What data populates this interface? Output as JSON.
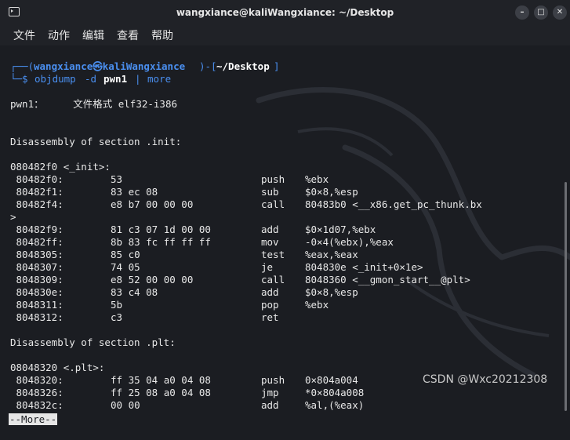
{
  "window": {
    "title": "wangxiance@kaliWangxiance: ~/Desktop",
    "buttons": {
      "minimize": "–",
      "maximize": "□",
      "close": "✕"
    }
  },
  "menu": [
    "文件",
    "动作",
    "编辑",
    "查看",
    "帮助"
  ],
  "prompt": {
    "line1_open": "┌──(",
    "user_host": "wangxiance㉿kaliWangxiance",
    "line1_mid": ")-[",
    "path": "~/Desktop",
    "line1_close": "]",
    "line2_prefix": "└─$",
    "cmd": "objdump",
    "flag": "-d",
    "arg": "pwn1",
    "pipe": "|",
    "pipe_cmd": "more"
  },
  "file_format_line": "pwn1：     文件格式 elf32-i386",
  "section_init_header": "Disassembly of section .init:",
  "init_label": "080482f0 <_init>:",
  "init_rows": [
    {
      "addr": " 80482f0:",
      "bytes": "53",
      "op": "push",
      "args": "%ebx"
    },
    {
      "addr": " 80482f1:",
      "bytes": "83 ec 08",
      "op": "sub",
      "args": "$0×8,%esp"
    },
    {
      "addr": " 80482f4:",
      "bytes": "e8 b7 00 00 00",
      "op": "call",
      "args": "80483b0 <__x86.get_pc_thunk.bx"
    },
    {
      "addr": ">",
      "bytes": "",
      "op": "",
      "args": ""
    },
    {
      "addr": " 80482f9:",
      "bytes": "81 c3 07 1d 00 00",
      "op": "add",
      "args": "$0×1d07,%ebx"
    },
    {
      "addr": " 80482ff:",
      "bytes": "8b 83 fc ff ff ff",
      "op": "mov",
      "args": "-0×4(%ebx),%eax"
    },
    {
      "addr": " 8048305:",
      "bytes": "85 c0",
      "op": "test",
      "args": "%eax,%eax"
    },
    {
      "addr": " 8048307:",
      "bytes": "74 05",
      "op": "je",
      "args": "804830e <_init+0×1e>"
    },
    {
      "addr": " 8048309:",
      "bytes": "e8 52 00 00 00",
      "op": "call",
      "args": "8048360 <__gmon_start__@plt>"
    },
    {
      "addr": " 804830e:",
      "bytes": "83 c4 08",
      "op": "add",
      "args": "$0×8,%esp"
    },
    {
      "addr": " 8048311:",
      "bytes": "5b",
      "op": "pop",
      "args": "%ebx"
    },
    {
      "addr": " 8048312:",
      "bytes": "c3",
      "op": "ret",
      "args": ""
    }
  ],
  "section_plt_header": "Disassembly of section .plt:",
  "plt_label": "08048320 <.plt>:",
  "plt_rows": [
    {
      "addr": " 8048320:",
      "bytes": "ff 35 04 a0 04 08",
      "op": "push",
      "args": "0×804a004"
    },
    {
      "addr": " 8048326:",
      "bytes": "ff 25 08 a0 04 08",
      "op": "jmp",
      "args": "*0×804a008"
    },
    {
      "addr": " 804832c:",
      "bytes": "00 00",
      "op": "add",
      "args": "%al,(%eax)"
    }
  ],
  "pager_prompt": "--More--",
  "watermark": "CSDN @Wxc20212308"
}
